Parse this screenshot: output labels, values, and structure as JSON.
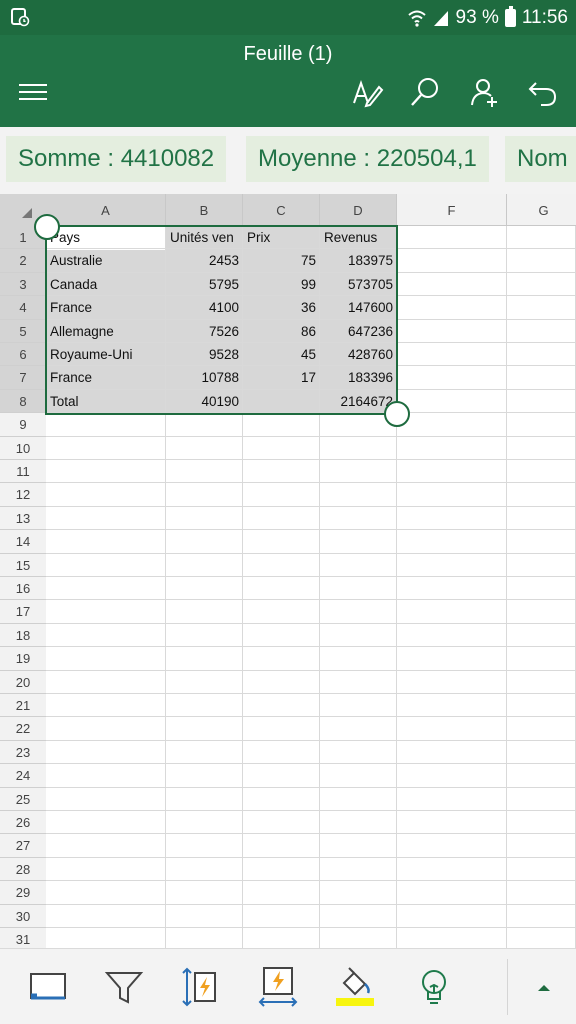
{
  "status": {
    "battery_percent": "93 %",
    "time": "11:56"
  },
  "header": {
    "title": "Feuille (1)"
  },
  "stats": [
    "Somme : 4410082",
    "Moyenne : 220504,1",
    "Nom"
  ],
  "columns": [
    "A",
    "B",
    "C",
    "D",
    "F",
    "G"
  ],
  "rows": [
    [
      "Pays",
      "Unités ven",
      "Prix",
      "Revenus"
    ],
    [
      "Australie",
      "2453",
      "75",
      "183975"
    ],
    [
      "Canada",
      "5795",
      "99",
      "573705"
    ],
    [
      "France",
      "4100",
      "36",
      "147600"
    ],
    [
      "Allemagne",
      "7526",
      "86",
      "647236"
    ],
    [
      "Royaume-Uni",
      "9528",
      "45",
      "428760"
    ],
    [
      "France",
      "10788",
      "17",
      "183396"
    ],
    [
      "Total",
      "40190",
      "",
      "2164672"
    ]
  ],
  "row_numbers": [
    "1",
    "2",
    "3",
    "4",
    "5",
    "6",
    "7",
    "8",
    "9",
    "10",
    "11",
    "12",
    "13",
    "14",
    "15",
    "16",
    "17",
    "18",
    "19",
    "20",
    "21",
    "22",
    "23",
    "24",
    "25",
    "26",
    "27",
    "28",
    "29",
    "30",
    "31"
  ],
  "toolbar": {
    "icons": [
      "freeze-panes-icon",
      "filter-icon",
      "autofit-row-icon",
      "autofit-column-icon",
      "fill-color-icon",
      "tell-me-icon",
      "expand-ribbon-icon"
    ]
  },
  "colors": {
    "brand": "#217346",
    "status": "#1e6b3f",
    "selection": "#d7d7d7",
    "fill_highlight": "#f7f50f"
  }
}
